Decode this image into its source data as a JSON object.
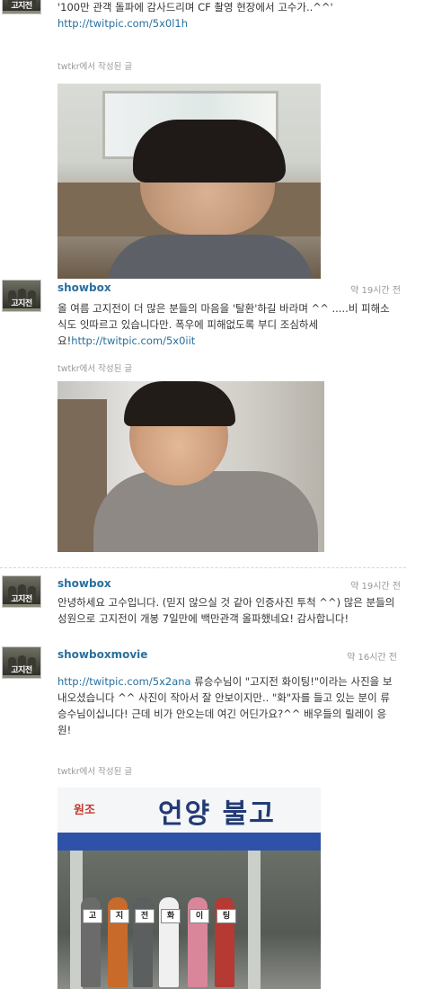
{
  "tweets": [
    {
      "text": "'100만 관객 돌파에 감사드리며 CF 촬영 현장에서 고수가..^^'",
      "link": "http://twitpic.com/5x0l1h",
      "via": "twtkr에서 작성된 글"
    },
    {
      "user": "showbox",
      "time": "약 19시간 전",
      "avatar_text": "고지전",
      "text": "올 여름 고지전이 더 많은 분들의 마음을 '탈환'하길 바라며 ^^ .....비 피해소식도 잇따르고 있습니다만. 폭우에 피해없도록 부디 조심하세요!",
      "link": "http://twitpic.com/5x0iit",
      "via": "twtkr에서 작성된 글"
    },
    {
      "user": "showbox",
      "time": "약 19시간 전",
      "avatar_text": "고지전",
      "text": "안녕하세요 고수입니다. (믿지 않으실 것 같아 인증사진 투척 ^^) 많은 분들의 성원으로 고지전이 개봉 7일만에 백만관객 올파했네요! 감사합니다!"
    },
    {
      "user": "showboxmovie",
      "time": "약 16시간 전",
      "avatar_text": "고지전",
      "link": "http://twitpic.com/5x2ana",
      "text": "류승수님이 \"고지전 화이팅!\"이라는 사진을 보내오셨습니다 ^^ 사진이 작아서 잘 안보이지만.. \"화\"자를 들고 있는 분이 류승수님이십니다! 근데 비가 안오는데 여긴 어딘가요?^^ 배우들의 릴레이 응원!",
      "via": "twtkr에서 작성된 글"
    }
  ],
  "photo3": {
    "sign_text": "언양 불고",
    "sign_logo": "원조",
    "cards": [
      "고",
      "지",
      "전",
      "화",
      "이",
      "팅"
    ]
  }
}
